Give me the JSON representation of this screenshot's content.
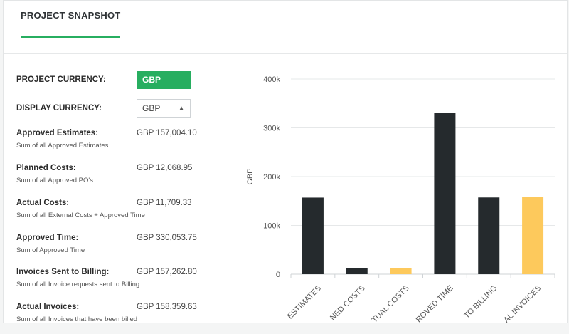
{
  "header": {
    "title": "PROJECT SNAPSHOT"
  },
  "project_currency": {
    "label": "PROJECT CURRENCY:",
    "value": "GBP"
  },
  "display_currency": {
    "label": "DISPLAY CURRENCY:",
    "value": "GBP"
  },
  "metrics": [
    {
      "name": "Approved Estimates:",
      "value": "GBP 157,004.10",
      "desc": "Sum of all Approved Estimates"
    },
    {
      "name": "Planned Costs:",
      "value": "GBP 12,068.95",
      "desc": "Sum of all Approved PO's"
    },
    {
      "name": "Actual Costs:",
      "value": "GBP 11,709.33",
      "desc": "Sum of all External Costs + Approved Time"
    },
    {
      "name": "Approved Time:",
      "value": "GBP 330,053.75",
      "desc": "Sum of Approved Time"
    },
    {
      "name": "Invoices Sent to Billing:",
      "value": "GBP 157,262.80",
      "desc": "Sum of all Invoice requests sent to Billing"
    },
    {
      "name": "Actual Invoices:",
      "value": "GBP 158,359.63",
      "desc": "Sum of all Invoices that have been billed"
    }
  ],
  "colors": {
    "accent": "#27ae60",
    "bar_dark": "#252a2d",
    "bar_yellow": "#fdc95c"
  },
  "chart_data": {
    "type": "bar",
    "categories": [
      "APPROVED ESTIMATES",
      "PLANNED COSTS",
      "ACTUAL COSTS",
      "APPROVED TIME",
      "INVOICES SENT TO BILLING",
      "ACTUAL INVOICES"
    ],
    "category_labels_visible": [
      "ESTIMATES",
      "NED COSTS",
      "TUAL COSTS",
      "ROVED TIME",
      "TO BILLING",
      "AL INVOICES"
    ],
    "values": [
      157004.1,
      12068.95,
      11709.33,
      330053.75,
      157262.8,
      158359.63
    ],
    "bar_colors": [
      "#252a2d",
      "#252a2d",
      "#fdc95c",
      "#252a2d",
      "#252a2d",
      "#fdc95c"
    ],
    "ylabel": "GBP",
    "ylim": [
      0,
      400000
    ],
    "yticks": [
      0,
      100000,
      200000,
      300000,
      400000
    ],
    "ytick_labels": [
      "0",
      "100k",
      "200k",
      "300k",
      "400k"
    ],
    "grid": true
  }
}
